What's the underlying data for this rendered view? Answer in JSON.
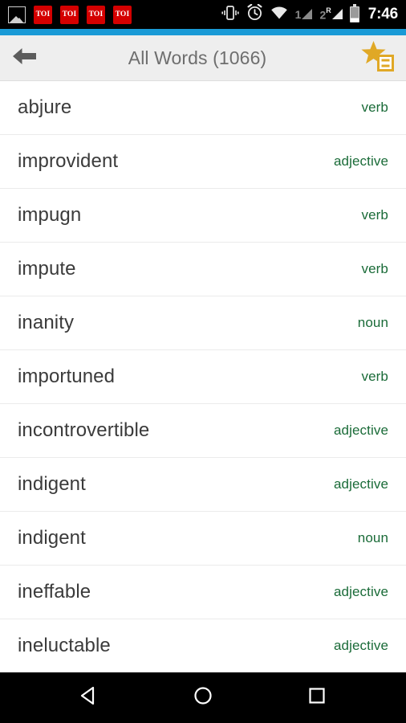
{
  "statusbar": {
    "icons": [
      {
        "name": "gallery-icon",
        "label": ""
      },
      {
        "name": "toi-notification-icon",
        "label": "TOI"
      },
      {
        "name": "toi-notification-icon",
        "label": "TOI"
      },
      {
        "name": "toi-notification-icon",
        "label": "TOI"
      },
      {
        "name": "toi-notification-icon",
        "label": "TOI"
      }
    ],
    "vibrate_icon": "vibrate-icon",
    "alarm_icon": "alarm-icon",
    "wifi_icon": "wifi-icon",
    "sim1_label": "1",
    "sim2_label": "2",
    "sim2_roaming_label": "R",
    "battery_icon": "battery-icon",
    "clock": "7:46",
    "background_color": "#000000"
  },
  "accent": {
    "color": "#1a9ad6"
  },
  "appbar": {
    "back_icon": "back-arrow-icon",
    "title": "All Words (1066)",
    "star_icon": "star-list-icon",
    "star_color": "#e0a826",
    "background_color": "#eeeeee",
    "title_color": "#6e6e6e"
  },
  "list": {
    "word_color": "#3b3b3b",
    "pos_color": "#1a6b38",
    "items": [
      {
        "word": "abjure",
        "pos": "verb"
      },
      {
        "word": "improvident",
        "pos": "adjective"
      },
      {
        "word": "impugn",
        "pos": "verb"
      },
      {
        "word": "impute",
        "pos": "verb"
      },
      {
        "word": "inanity",
        "pos": "noun"
      },
      {
        "word": "importuned",
        "pos": "verb"
      },
      {
        "word": "incontrovertible",
        "pos": "adjective"
      },
      {
        "word": "indigent",
        "pos": "adjective"
      },
      {
        "word": "indigent",
        "pos": "noun"
      },
      {
        "word": "ineffable",
        "pos": "adjective"
      },
      {
        "word": "ineluctable",
        "pos": "adjective"
      }
    ]
  },
  "navbar": {
    "back_label": "back-nav-icon",
    "home_label": "home-nav-icon",
    "recents_label": "recents-nav-icon",
    "background_color": "#000000"
  }
}
